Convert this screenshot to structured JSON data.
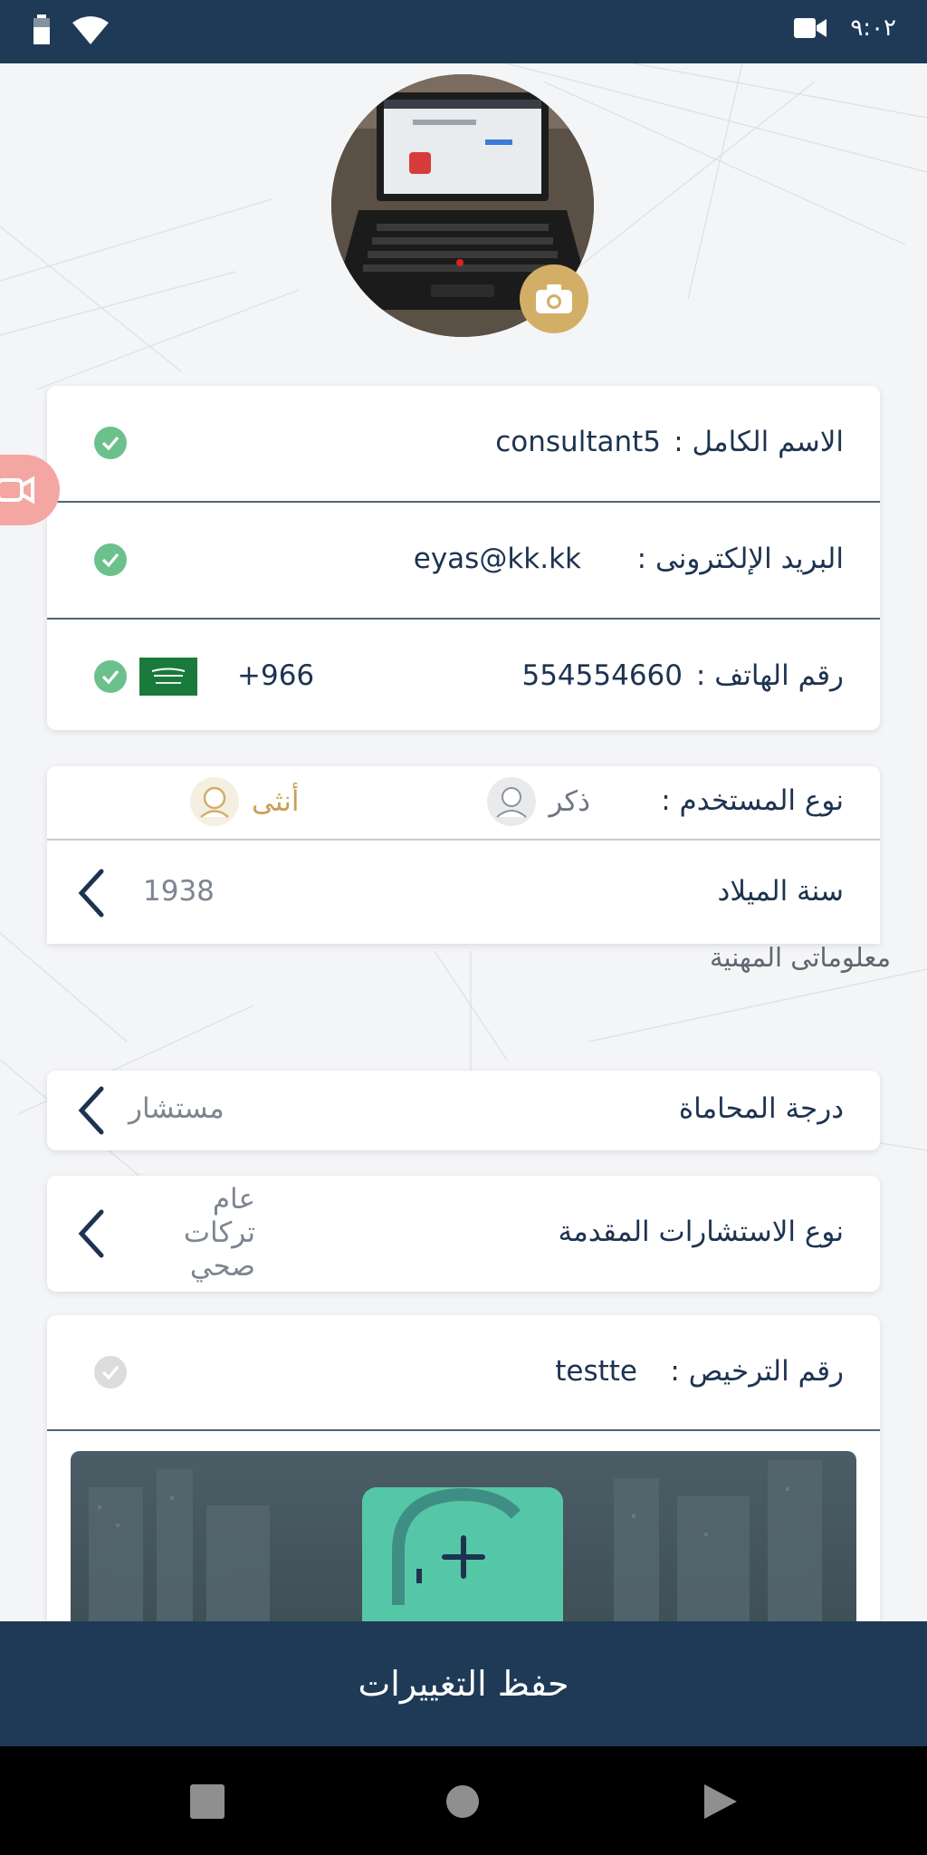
{
  "status_bar": {
    "time": "٩:٠٢"
  },
  "profile": {
    "avatar_alt": "صورة الملف الشخصي"
  },
  "personal": {
    "full_name_label": "الاسم الكامل :",
    "full_name_value": "consultant5",
    "email_label": "البريد الإلكترونى :",
    "email_value": "eyas@kk.kk",
    "phone_label": "رقم الهاتف :",
    "phone_value": "554554660",
    "country_code": "+966"
  },
  "user_type": {
    "label": "نوع المستخدم :",
    "male": "ذكر",
    "female": "أنثى"
  },
  "birth_year": {
    "label": "سنة الميلاد",
    "value": "1938"
  },
  "professional": {
    "section_title": "معلوماتى المهنية",
    "advocacy_label": "درجة المحاماة",
    "advocacy_value": "مستشار",
    "consult_type_label": "نوع الاستشارات المقدمة",
    "consult_types": [
      "عام",
      "تركات",
      "صحي"
    ],
    "license_label": "رقم الترخيص :",
    "license_value": "testte"
  },
  "actions": {
    "save_label": "حفظ التغييرات"
  },
  "colors": {
    "primary": "#1f3a56",
    "accent_gold": "#d2ae67",
    "success": "#6cc08c",
    "teal": "#56c7a6"
  }
}
